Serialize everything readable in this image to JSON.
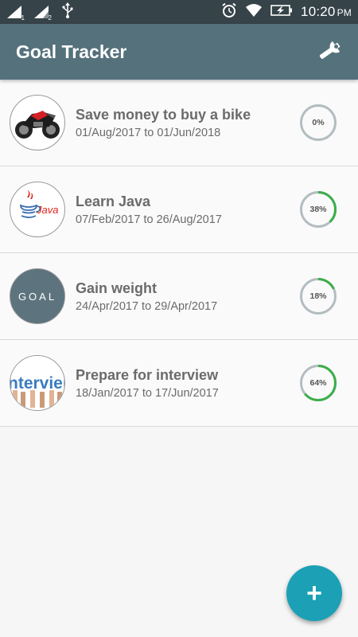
{
  "status_bar": {
    "sim1_label": "1",
    "sim2_label": "2",
    "time": "10:20",
    "ampm": "PM",
    "icons": [
      "signal-icon",
      "signal-icon",
      "usb-icon",
      "alarm-icon",
      "wifi-icon",
      "battery-icon"
    ]
  },
  "app_bar": {
    "title": "Goal Tracker",
    "settings_icon": "wrench-icon"
  },
  "goals": [
    {
      "title": "Save money to buy a bike",
      "dates": "01/Aug/2017 to 01/Jun/2018",
      "progress": 0,
      "progress_label": "0%",
      "image": "bike"
    },
    {
      "title": "Learn Java",
      "dates": "07/Feb/2017 to 26/Aug/2017",
      "progress": 38,
      "progress_label": "38%",
      "image": "java"
    },
    {
      "title": "Gain weight",
      "dates": "24/Apr/2017 to 29/Apr/2017",
      "progress": 18,
      "progress_label": "18%",
      "image": "goal",
      "image_text": "GOAL"
    },
    {
      "title": "Prepare for interview",
      "dates": "18/Jan/2017 to 17/Jun/2017",
      "progress": 64,
      "progress_label": "64%",
      "image": "interview",
      "image_text": "nterviei"
    }
  ],
  "fab": {
    "label": "+",
    "icon": "plus-icon"
  },
  "colors": {
    "status_bar": "#364349",
    "app_bar": "#55717c",
    "progress_track": "#b3bdc0",
    "progress_fill": "#3cae4a",
    "fab": "#1ba0b5",
    "java_red": "#e2231a",
    "java_blue": "#3a6fb0",
    "goal_bg": "#5d737e"
  }
}
